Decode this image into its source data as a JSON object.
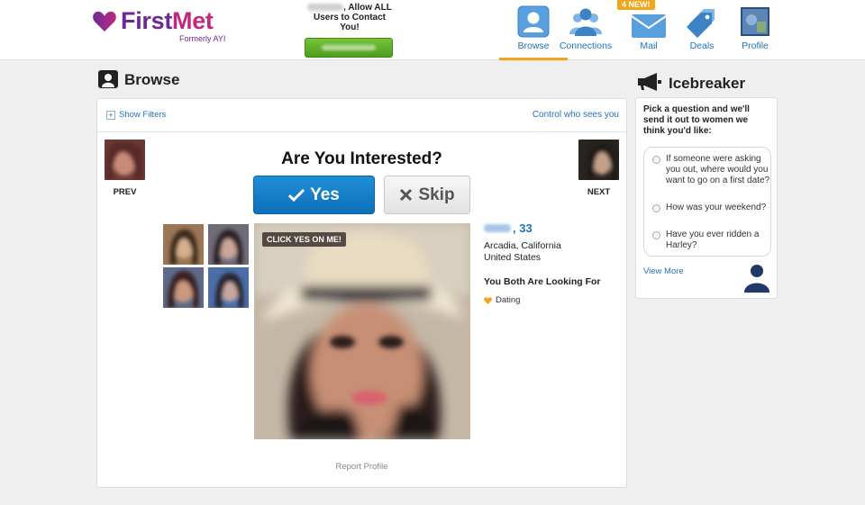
{
  "brand": {
    "name_first": "First",
    "name_second": "Met",
    "tagline": "Formerly AYI",
    "colors": {
      "purple": "#6d2a96",
      "pink": "#c2277e",
      "link": "#1e73be",
      "active": "#f3a51a"
    }
  },
  "promo": {
    "text_suffix": ", Allow ALL Users to Contact You!",
    "button_icon": "upgrade-button-blurred"
  },
  "nav": [
    {
      "label": "Browse",
      "icon": "person-card-icon",
      "active": true
    },
    {
      "label": "Connections",
      "icon": "people-icon"
    },
    {
      "label": "Mail",
      "icon": "envelope-icon",
      "badge": "4 NEW!"
    },
    {
      "label": "Deals",
      "icon": "tags-icon"
    },
    {
      "label": "Profile",
      "icon": "profile-photo"
    }
  ],
  "browse": {
    "title": "Browse",
    "show_filters": "Show Filters",
    "control_link": "Control who sees you",
    "prev_label": "PREV",
    "next_label": "NEXT",
    "question": "Are You Interested?",
    "yes_label": "Yes",
    "skip_label": "Skip",
    "photo_tag": "CLICK YES ON ME!",
    "profile": {
      "age_text": ", 33",
      "city": "Arcadia, California",
      "country": "United States",
      "looking_heading": "You Both Are Looking For",
      "looking_item": "Dating"
    },
    "report": "Report Profile"
  },
  "icebreaker": {
    "title": "Icebreaker",
    "intro": "Pick a question and we'll send it out to women we think you'd like:",
    "questions": [
      "If someone were asking you out, where would you want to go on a first date?",
      "How was your weekend?",
      "Have you ever ridden a Harley?"
    ],
    "view_more": "View More"
  }
}
